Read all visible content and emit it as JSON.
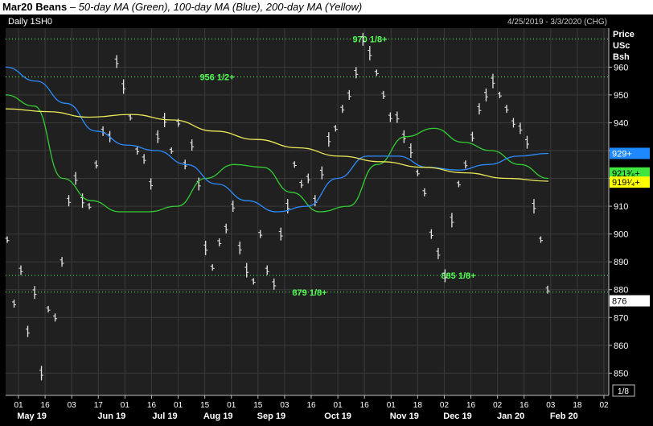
{
  "title": {
    "symbol": "Mar20 Beans",
    "description": " – 50-day MA (Green), 100-day MA (Blue), 200-day MA (Yellow)"
  },
  "panel": {
    "label": "Daily 1SH0",
    "date_range": "4/25/2019 - 3/3/2020 (CHG)",
    "axis_title": [
      "Price",
      "USc",
      "Bsh"
    ],
    "corner_label": "1/8"
  },
  "colors": {
    "background": "#000000",
    "plot": "#202020",
    "price_bars": "#e6e6e6",
    "ma50": "#33cc33",
    "ma100": "#2b8cff",
    "ma200": "#e8e85a",
    "levels": "#55ff55",
    "tag_blue": "#1e88ff",
    "tag_green": "#3ee63e",
    "tag_yellow": "#ffff00",
    "tag_white": "#ffffff"
  },
  "chart_data": {
    "type": "line",
    "title": "Mar20 Beans",
    "subtitle": "50-day MA (Green), 100-day MA (Blue), 200-day MA (Yellow)",
    "ylabel": "Price USc Bsh",
    "ylim": [
      842,
      974
    ],
    "y_ticks": [
      850,
      860,
      870,
      880,
      890,
      900,
      910,
      920,
      930,
      940,
      950,
      960
    ],
    "x_ticks": [
      "01",
      "16",
      "03",
      "17",
      "01",
      "16",
      "01",
      "15",
      "01",
      "15",
      "03",
      "16",
      "01",
      "16",
      "01",
      "18",
      "02",
      "16",
      "02",
      "16",
      "03",
      "18",
      "02"
    ],
    "months": [
      "May 19",
      "Jun 19",
      "Jul 19",
      "Aug 19",
      "Sep 19",
      "Oct 19",
      "Nov 19",
      "Dec 19",
      "Jan 20",
      "Feb 20"
    ],
    "levels": [
      {
        "value": 970.125,
        "label": "970 1/8+"
      },
      {
        "value": 956.5,
        "label": "956 1/2+"
      },
      {
        "value": 885.125,
        "label": "885 1/8+"
      },
      {
        "value": 879.125,
        "label": "879 1/8+"
      }
    ],
    "last_price": {
      "value": 876,
      "label": "876"
    },
    "ma_tags": [
      {
        "name": "100-day MA",
        "value": 929,
        "label": "929+"
      },
      {
        "name": "50-day MA",
        "value": 921.375,
        "label": "921³⁄₈+"
      },
      {
        "name": "200-day MA",
        "value": 919.25,
        "label": "919¹⁄₄+"
      }
    ],
    "series": [
      {
        "name": "Price",
        "values": [
          898,
          875,
          887,
          865,
          879,
          850,
          873,
          870,
          890,
          912,
          920,
          912,
          910,
          925,
          937,
          935,
          962,
          953,
          942,
          930,
          927,
          918,
          935,
          941,
          930,
          940,
          925,
          932,
          918,
          895,
          888,
          897,
          902,
          910,
          895,
          887,
          883,
          900,
          887,
          882,
          900,
          910,
          925,
          918,
          920,
          912,
          922,
          934,
          938,
          945,
          950,
          958,
          970,
          965,
          958,
          950,
          942,
          942,
          935,
          930,
          922,
          915,
          900,
          893,
          885,
          905,
          918,
          925,
          935,
          945,
          950,
          955,
          950,
          945,
          940,
          938,
          933,
          910,
          898,
          880
        ]
      },
      {
        "name": "50-day MA",
        "values": [
          950,
          946,
          920,
          912,
          908,
          908,
          910,
          920,
          925,
          924,
          915,
          908,
          910,
          925,
          935,
          938,
          933,
          930,
          925,
          920
        ]
      },
      {
        "name": "100-day MA",
        "values": [
          960,
          955,
          947,
          937,
          932,
          930,
          925,
          918,
          912,
          908,
          910,
          920,
          928,
          928,
          924,
          923,
          925,
          928,
          929
        ]
      },
      {
        "name": "200-day MA",
        "values": [
          945,
          944,
          942,
          943,
          941,
          937,
          934,
          931,
          928,
          926,
          924,
          922,
          920,
          919
        ]
      }
    ]
  }
}
